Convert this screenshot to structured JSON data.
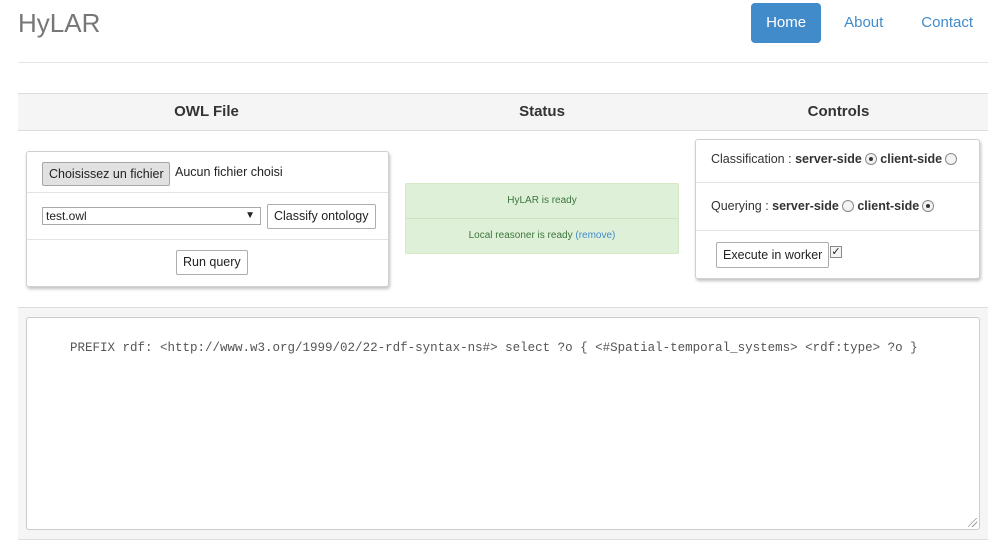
{
  "brand": "HyLAR",
  "nav": {
    "home": "Home",
    "about": "About",
    "contact": "Contact"
  },
  "columns": {
    "owl_file": "OWL File",
    "status": "Status",
    "controls": "Controls"
  },
  "owl_panel": {
    "choose_file_label": "Choisissez un fichier",
    "file_status": "Aucun fichier choisi",
    "ontology_selected": "test.owl",
    "classify_label": "Classify ontology",
    "run_query_label": "Run query"
  },
  "status_panel": {
    "line1": "HyLAR is ready",
    "line2": "Local reasoner is ready",
    "remove_link": "(remove)"
  },
  "controls_panel": {
    "classification_label": "Classification :",
    "querying_label": "Querying :",
    "server_side": "server-side",
    "client_side": "client-side",
    "execute_worker_label": "Execute in worker",
    "classification_mode": "server-side",
    "querying_mode": "client-side",
    "execute_in_worker": true
  },
  "query": {
    "text": "PREFIX rdf: <http://www.w3.org/1999/02/22-rdf-syntax-ns#> select ?o { <#Spatial-temporal_systems> <rdf:type> ?o }"
  },
  "colors": {
    "accent": "#428bca",
    "success_bg": "#dff0d8",
    "success_text": "#3c763d"
  },
  "icons": [
    "chevron-down-icon",
    "resize-grip-icon"
  ]
}
